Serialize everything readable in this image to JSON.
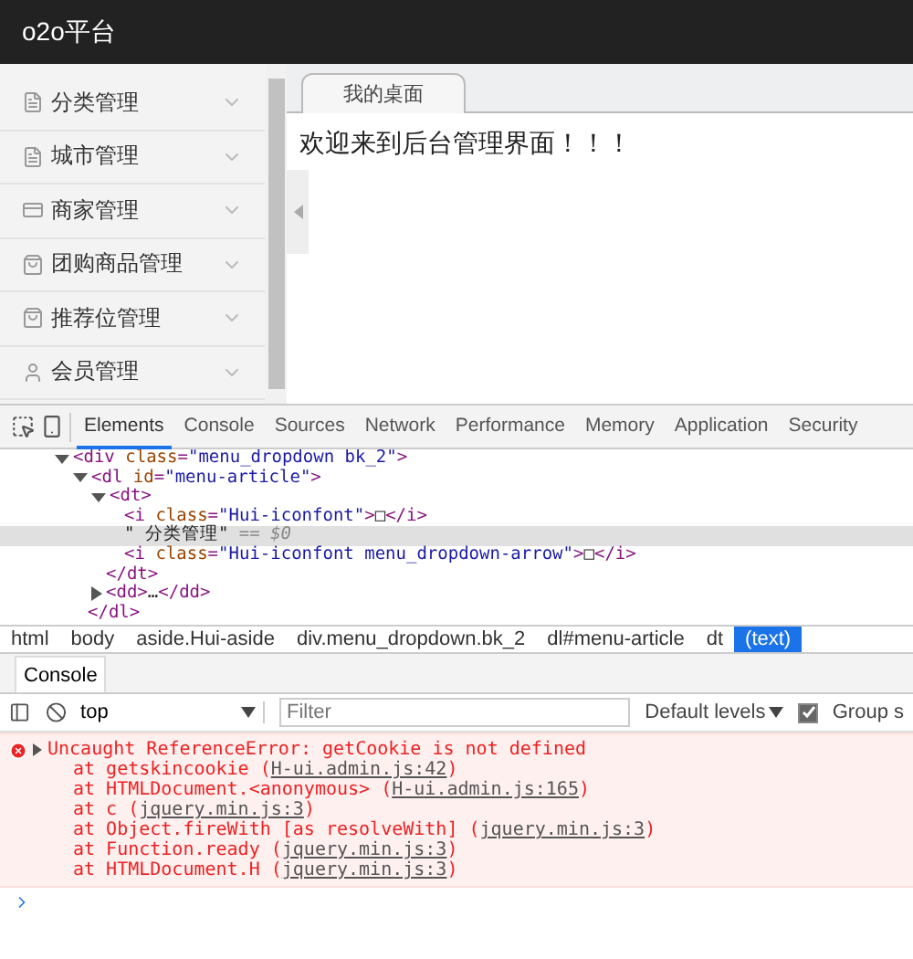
{
  "header": {
    "title": "o2o平台"
  },
  "sidebar": {
    "items": [
      {
        "label": "分类管理",
        "kind": "document",
        "expanded": false
      },
      {
        "label": "城市管理",
        "kind": "document",
        "expanded": false
      },
      {
        "label": "商家管理",
        "kind": "card",
        "expanded": false
      },
      {
        "label": "团购商品管理",
        "kind": "bag",
        "expanded": false
      },
      {
        "label": "推荐位管理",
        "kind": "bag",
        "expanded": false
      },
      {
        "label": "会员管理",
        "kind": "user",
        "expanded": false
      }
    ]
  },
  "content": {
    "tabs": [
      {
        "label": "我的桌面",
        "selected": true
      }
    ],
    "welcome": "欢迎来到后台管理界面！！！"
  },
  "devtools": {
    "tabs": [
      {
        "label": "Elements",
        "selected": true
      },
      {
        "label": "Console",
        "selected": false
      },
      {
        "label": "Sources",
        "selected": false
      },
      {
        "label": "Network",
        "selected": false
      },
      {
        "label": "Performance",
        "selected": false
      },
      {
        "label": "Memory",
        "selected": false
      },
      {
        "label": "Application",
        "selected": false
      },
      {
        "label": "Security",
        "selected": false
      }
    ],
    "dom": [
      {
        "label": "<div class=\"menu_dropdown bk_2\">",
        "expanded": true,
        "selected": false,
        "children": [
          {
            "label": "<dl id=\"menu-article\">",
            "expanded": true,
            "selected": false,
            "close": "</dl>",
            "children": [
              {
                "label": "<dt>",
                "expanded": true,
                "selected": false,
                "close": "</dt>",
                "children": [
                  {
                    "label": "<i class=\"Hui-iconfont\">□</i>",
                    "selected": false
                  },
                  {
                    "label": "\" 分类管理\"",
                    "note": "== $0",
                    "selected": true
                  },
                  {
                    "label": "<i class=\"Hui-iconfont menu_dropdown-arrow\">□</i>",
                    "selected": false
                  }
                ]
              },
              {
                "label": "<dd>…</dd>",
                "expanded": false,
                "selected": false
              }
            ]
          }
        ]
      }
    ],
    "breadcrumbs": [
      {
        "label": "html",
        "selected": false
      },
      {
        "label": "body",
        "selected": false
      },
      {
        "label": "aside.Hui-aside",
        "selected": false
      },
      {
        "label": "div.menu_dropdown.bk_2",
        "selected": false
      },
      {
        "label": "dl#menu-article",
        "selected": false
      },
      {
        "label": "dt",
        "selected": false
      },
      {
        "label": "(text)",
        "selected": true
      }
    ],
    "drawer_tabs": [
      {
        "label": "Console",
        "selected": true
      }
    ],
    "console_toolbar": {
      "context": "top",
      "filter_placeholder": "Filter",
      "levels": "Default levels",
      "group_label": "Group s",
      "group_checked": true
    },
    "messages": [
      {
        "kind": "error",
        "text": "Uncaught ReferenceError: getCookie is not defined",
        "stack": [
          {
            "prefix": "at getskincookie (",
            "link": "H-ui.admin.js:42",
            "suffix": ")"
          },
          {
            "prefix": "at HTMLDocument.<anonymous> (",
            "link": "H-ui.admin.js:165",
            "suffix": ")"
          },
          {
            "prefix": "at c (",
            "link": "jquery.min.js:3",
            "suffix": ")"
          },
          {
            "prefix": "at Object.fireWith [as resolveWith] (",
            "link": "jquery.min.js:3",
            "suffix": ")"
          },
          {
            "prefix": "at Function.ready (",
            "link": "jquery.min.js:3",
            "suffix": ")"
          },
          {
            "prefix": "at HTMLDocument.H (",
            "link": "jquery.min.js:3",
            "suffix": ")"
          }
        ]
      }
    ]
  }
}
